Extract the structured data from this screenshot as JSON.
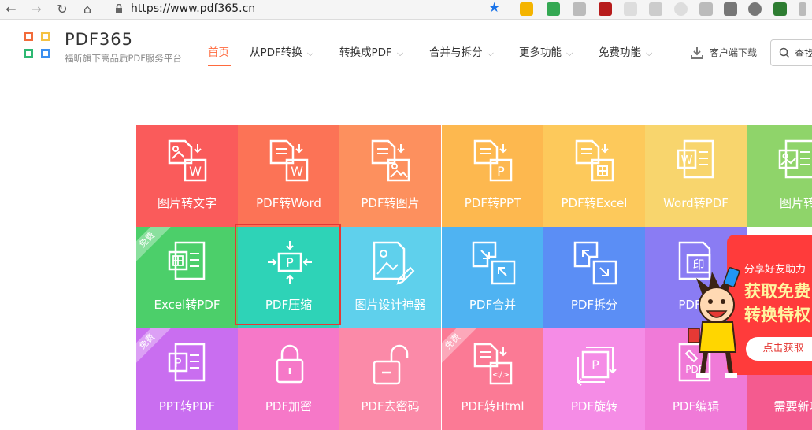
{
  "browser": {
    "url": "https://www.pdf365.cn",
    "nav_icons": [
      "back-icon",
      "forward-icon",
      "reload-icon",
      "home-icon"
    ]
  },
  "header": {
    "brand": "PDF365",
    "slogan": "福昕旗下高品质PDF服务平台",
    "menu": [
      {
        "label": "首页"
      },
      {
        "label": "从PDF转换"
      },
      {
        "label": "转换成PDF"
      },
      {
        "label": "合并与拆分"
      },
      {
        "label": "更多功能"
      },
      {
        "label": "免费功能"
      }
    ],
    "download_label": "客户端下载",
    "search_label": "查找"
  },
  "tiles": {
    "row1": [
      {
        "label": "图片转文字"
      },
      {
        "label": "PDF转Word"
      },
      {
        "label": "PDF转图片"
      },
      {
        "label": "PDF转PPT"
      },
      {
        "label": "PDF转Excel"
      },
      {
        "label": "Word转PDF"
      },
      {
        "label": "图片转"
      }
    ],
    "row2": [
      {
        "label": "Excel转PDF",
        "badge": "免费"
      },
      {
        "label": "PDF压缩"
      },
      {
        "label": "图片设计神器"
      },
      {
        "label": "PDF合并"
      },
      {
        "label": "PDF拆分"
      },
      {
        "label": "PDF加"
      }
    ],
    "row3": [
      {
        "label": "PPT转PDF",
        "badge": "免费"
      },
      {
        "label": "PDF加密"
      },
      {
        "label": "PDF去密码"
      },
      {
        "label": "PDF转Html",
        "badge": "免费"
      },
      {
        "label": "PDF旋转"
      },
      {
        "label": "PDF编辑"
      },
      {
        "label": "需要新功"
      }
    ]
  },
  "promo": {
    "subtitle": "分享好友助力",
    "headline1": "获取免费",
    "headline2": "转换特权",
    "button": "点击获取"
  },
  "colors": {
    "accent": "#ff6a3d",
    "selected_border": "#e53935",
    "promo": "#ff3b3b"
  }
}
